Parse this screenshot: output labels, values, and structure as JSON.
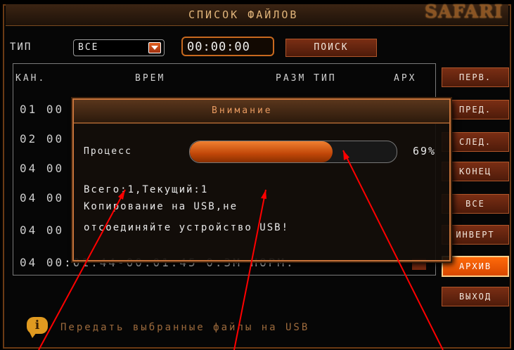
{
  "header": {
    "title": "СПИСОК ФАЙЛОВ",
    "logo": "SAFARI"
  },
  "filters": {
    "type_label": "ТИП",
    "type_value": "ВСЕ",
    "time_value": "00:00:00",
    "search_label": "ПОИСК"
  },
  "table": {
    "headers": {
      "channel": "КАН.",
      "time": "ВРЕМ",
      "size_type": "РАЗМ ТИП",
      "archive": "АРХ"
    },
    "rows": [
      "01 00",
      "02 00",
      "04 00",
      "04 00",
      "04 00",
      "04 00:01:44-00:01:45   0.3M НОРМ."
    ]
  },
  "side_buttons": [
    "ПЕРВ.",
    "ПРЕД.",
    "СЛЕД.",
    "КОНЕЦ",
    "ВСЕ",
    "ИНВЕРТ",
    "АРХИВ",
    "ВЫХОД"
  ],
  "dialog": {
    "title": "Внимание",
    "process_label": "Процесс",
    "progress_percent": 69,
    "progress_text": "69%",
    "counter": "Всего:1,Текущий:1",
    "message_line1": "Копирование на USB,не",
    "message_line2": "отсоединяйте устройство USB!"
  },
  "hint": "Передать выбранные файлы на USB",
  "colors": {
    "accent": "#d84800",
    "border": "#6b3a14",
    "annotation_arrow": "#ff0000"
  }
}
